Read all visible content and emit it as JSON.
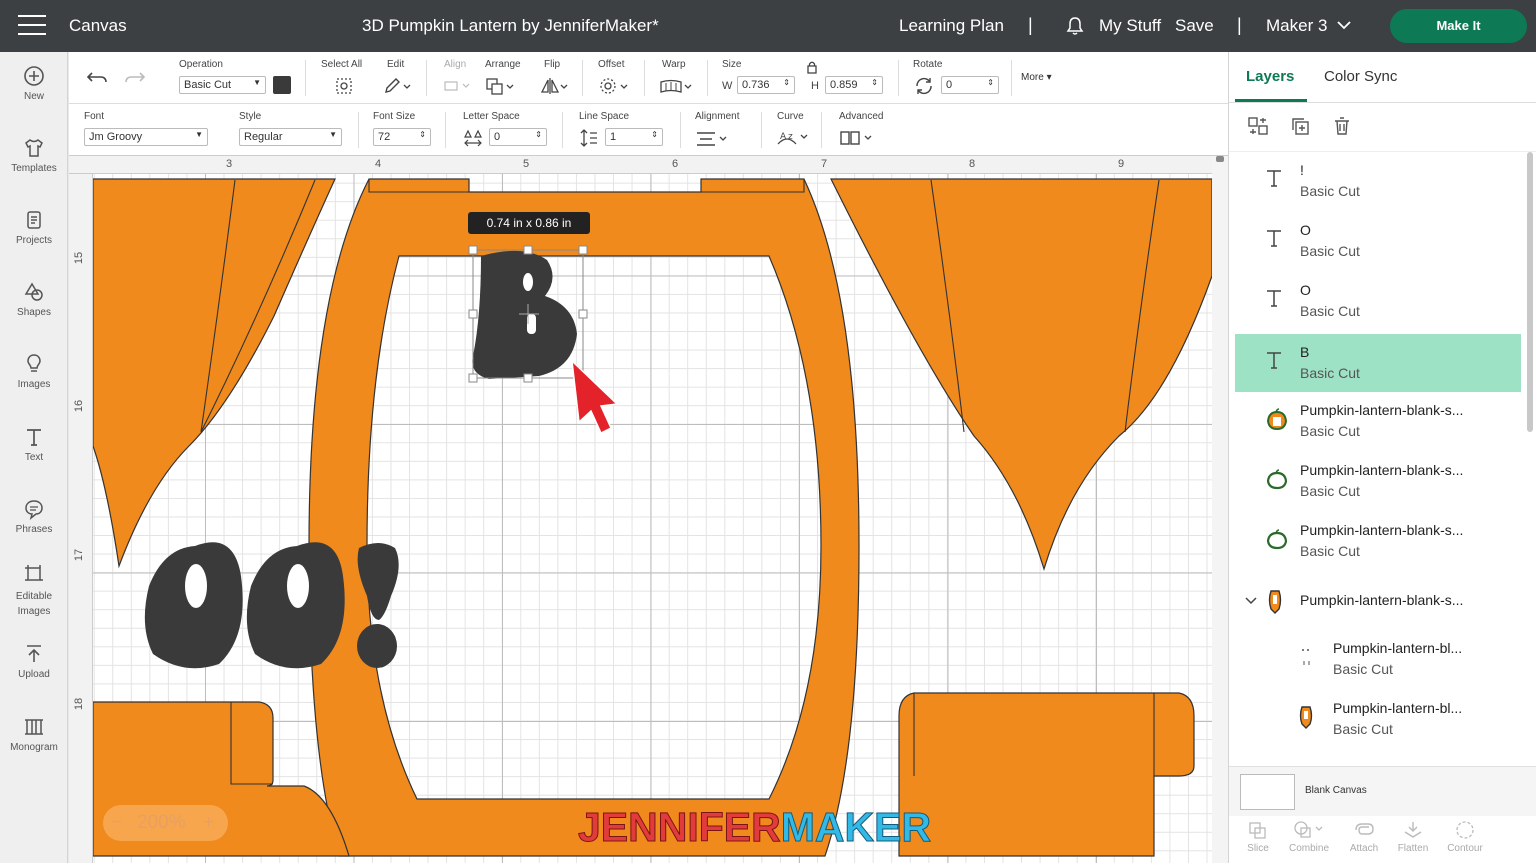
{
  "header": {
    "app_title": "Canvas",
    "project_title": "3D Pumpkin Lantern by JenniferMaker*",
    "learning_plan": "Learning Plan",
    "separator": "|",
    "my_stuff": "My Stuff",
    "save": "Save",
    "machine": "Maker 3",
    "make_it": "Make It"
  },
  "sidebar": {
    "items": [
      {
        "label": "New",
        "icon": "plus-circle-icon"
      },
      {
        "label": "Templates",
        "icon": "shirt-icon"
      },
      {
        "label": "Projects",
        "icon": "projects-icon"
      },
      {
        "label": "Shapes",
        "icon": "shapes-icon"
      },
      {
        "label": "Images",
        "icon": "lightbulb-icon"
      },
      {
        "label": "Text",
        "icon": "text-icon"
      },
      {
        "label": "Phrases",
        "icon": "speech-bubble-icon"
      },
      {
        "label": "Editable Images",
        "icon": "editable-images-icon"
      },
      {
        "label": "Upload",
        "icon": "upload-icon"
      },
      {
        "label": "Monogram",
        "icon": "monogram-icon"
      }
    ]
  },
  "toolbar1": {
    "operation_label": "Operation",
    "operation_value": "Basic Cut",
    "select_all": "Select All",
    "edit": "Edit",
    "align": "Align",
    "arrange": "Arrange",
    "flip": "Flip",
    "offset": "Offset",
    "warp": "Warp",
    "size": "Size",
    "w_label": "W",
    "w_value": "0.736",
    "h_label": "H",
    "h_value": "0.859",
    "rotate": "Rotate",
    "rotate_value": "0",
    "more": "More"
  },
  "toolbar2": {
    "font_label": "Font",
    "font_value": "Jm Groovy",
    "style_label": "Style",
    "style_value": "Regular",
    "font_size_label": "Font Size",
    "font_size_value": "72",
    "letter_space_label": "Letter Space",
    "letter_space_value": "0",
    "line_space_label": "Line Space",
    "line_space_value": "1",
    "alignment_label": "Alignment",
    "curve_label": "Curve",
    "advanced_label": "Advanced"
  },
  "canvas": {
    "ruler_top": [
      "3",
      "4",
      "5",
      "6",
      "7",
      "8",
      "9"
    ],
    "ruler_left": [
      "15",
      "16",
      "17",
      "18"
    ],
    "size_badge": "0.74  in x 0.86  in",
    "zoom_level": "200%",
    "zoom_minus": "−",
    "zoom_plus": "+",
    "watermark_part1": "JENNIFER",
    "watermark_part2": "MAKER",
    "art_orange": "#f08a1c",
    "art_dark": "#3a3a3a"
  },
  "panel": {
    "tabs": [
      "Layers",
      "Color Sync"
    ],
    "layers": [
      {
        "name": "!",
        "op": "Basic Cut",
        "icon": "text-icon"
      },
      {
        "name": "O",
        "op": "Basic Cut",
        "icon": "text-icon"
      },
      {
        "name": "O",
        "op": "Basic Cut",
        "icon": "text-icon"
      },
      {
        "name": "B",
        "op": "Basic Cut",
        "icon": "text-icon",
        "selected": true
      },
      {
        "name": "Pumpkin-lantern-blank-s...",
        "op": "Basic Cut",
        "icon": "pumpkin-icon"
      },
      {
        "name": "Pumpkin-lantern-blank-s...",
        "op": "Basic Cut",
        "icon": "pumpkin-outline-icon"
      },
      {
        "name": "Pumpkin-lantern-blank-s...",
        "op": "Basic Cut",
        "icon": "pumpkin-outline-icon"
      },
      {
        "name": "Pumpkin-lantern-blank-s...",
        "op": "",
        "icon": "group-icon"
      },
      {
        "name": "Pumpkin-lantern-bl...",
        "op": "Basic Cut",
        "icon": "dots-icon"
      },
      {
        "name": "Pumpkin-lantern-bl...",
        "op": "Basic Cut",
        "icon": "lantern-icon"
      }
    ],
    "blank_canvas": "Blank Canvas",
    "actions": [
      "Slice",
      "Combine",
      "Attach",
      "Flatten",
      "Contour"
    ]
  }
}
